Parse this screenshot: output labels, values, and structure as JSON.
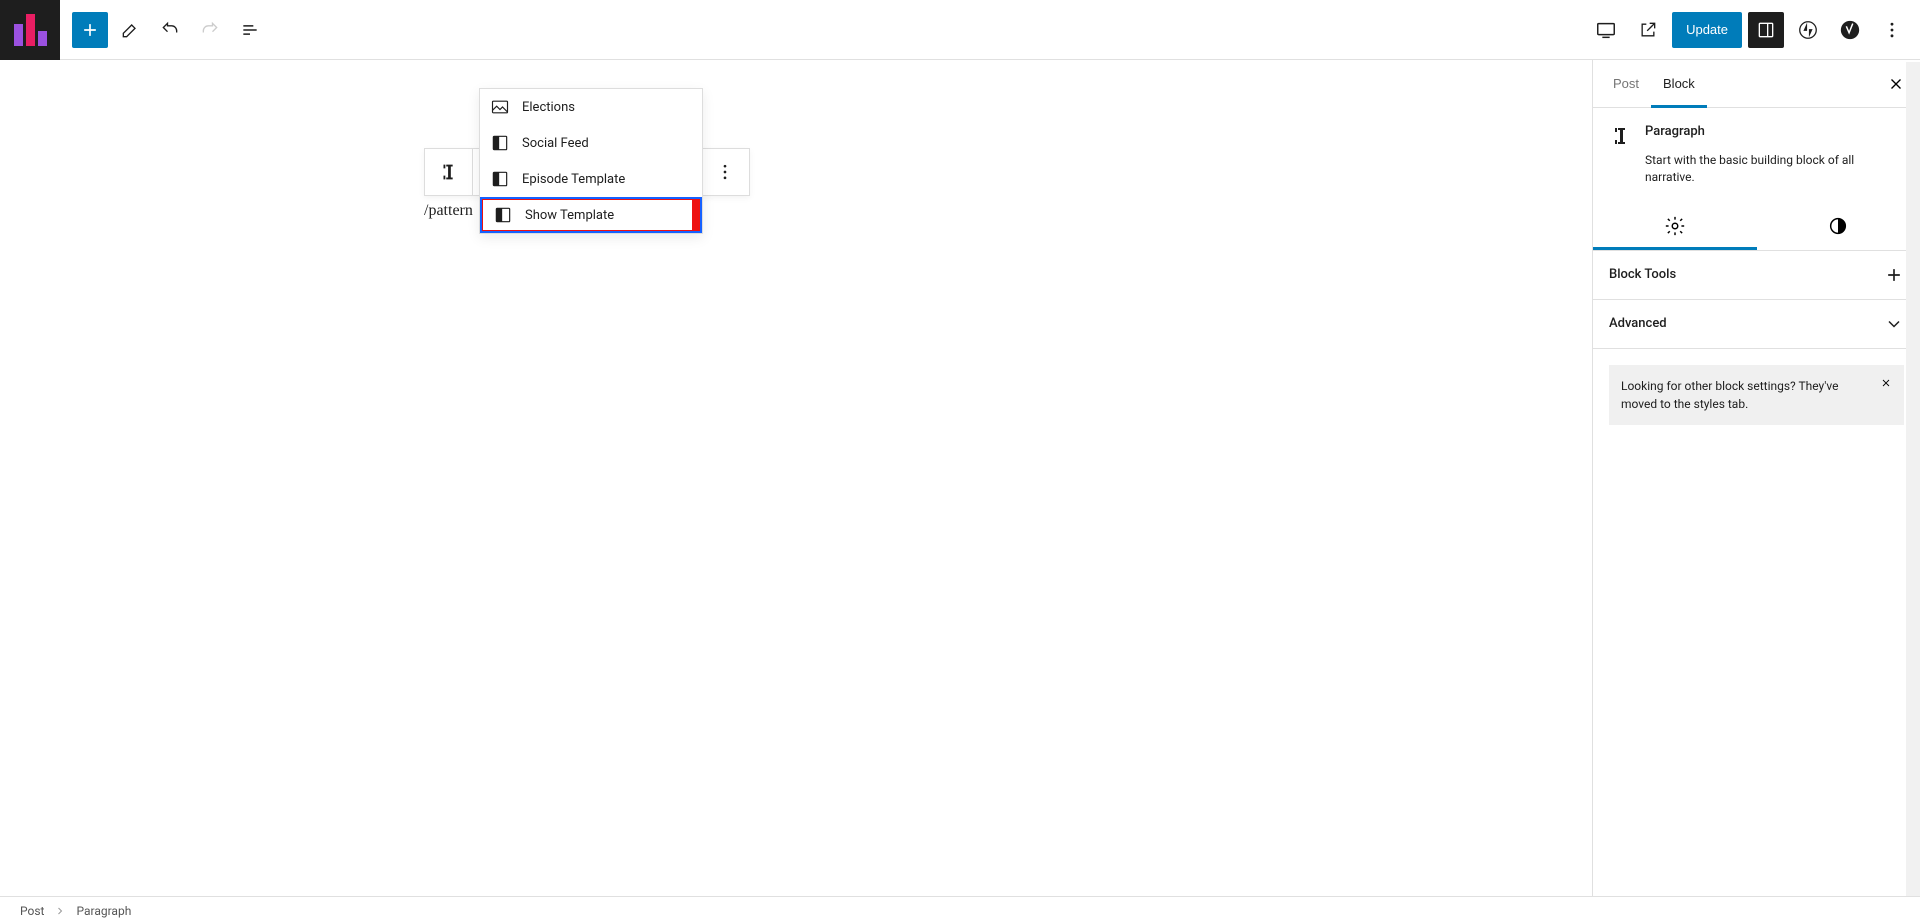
{
  "topbar": {
    "add_label": "Add block",
    "update_label": "Update"
  },
  "suggestions": {
    "items": [
      {
        "label": "Elections",
        "icon": "image"
      },
      {
        "label": "Social Feed",
        "icon": "pattern"
      },
      {
        "label": "Episode Template",
        "icon": "pattern"
      },
      {
        "label": "Show Template",
        "icon": "pattern"
      }
    ]
  },
  "editor": {
    "slash_text": "/pattern"
  },
  "sidebar": {
    "tabs": {
      "post": "Post",
      "block": "Block"
    },
    "block": {
      "title": "Paragraph",
      "description": "Start with the basic building block of all narrative."
    },
    "panels": {
      "block_tools": "Block Tools",
      "advanced": "Advanced"
    },
    "notice": "Looking for other block settings? They've moved to the styles tab."
  },
  "breadcrumb": {
    "root": "Post",
    "current": "Paragraph"
  }
}
